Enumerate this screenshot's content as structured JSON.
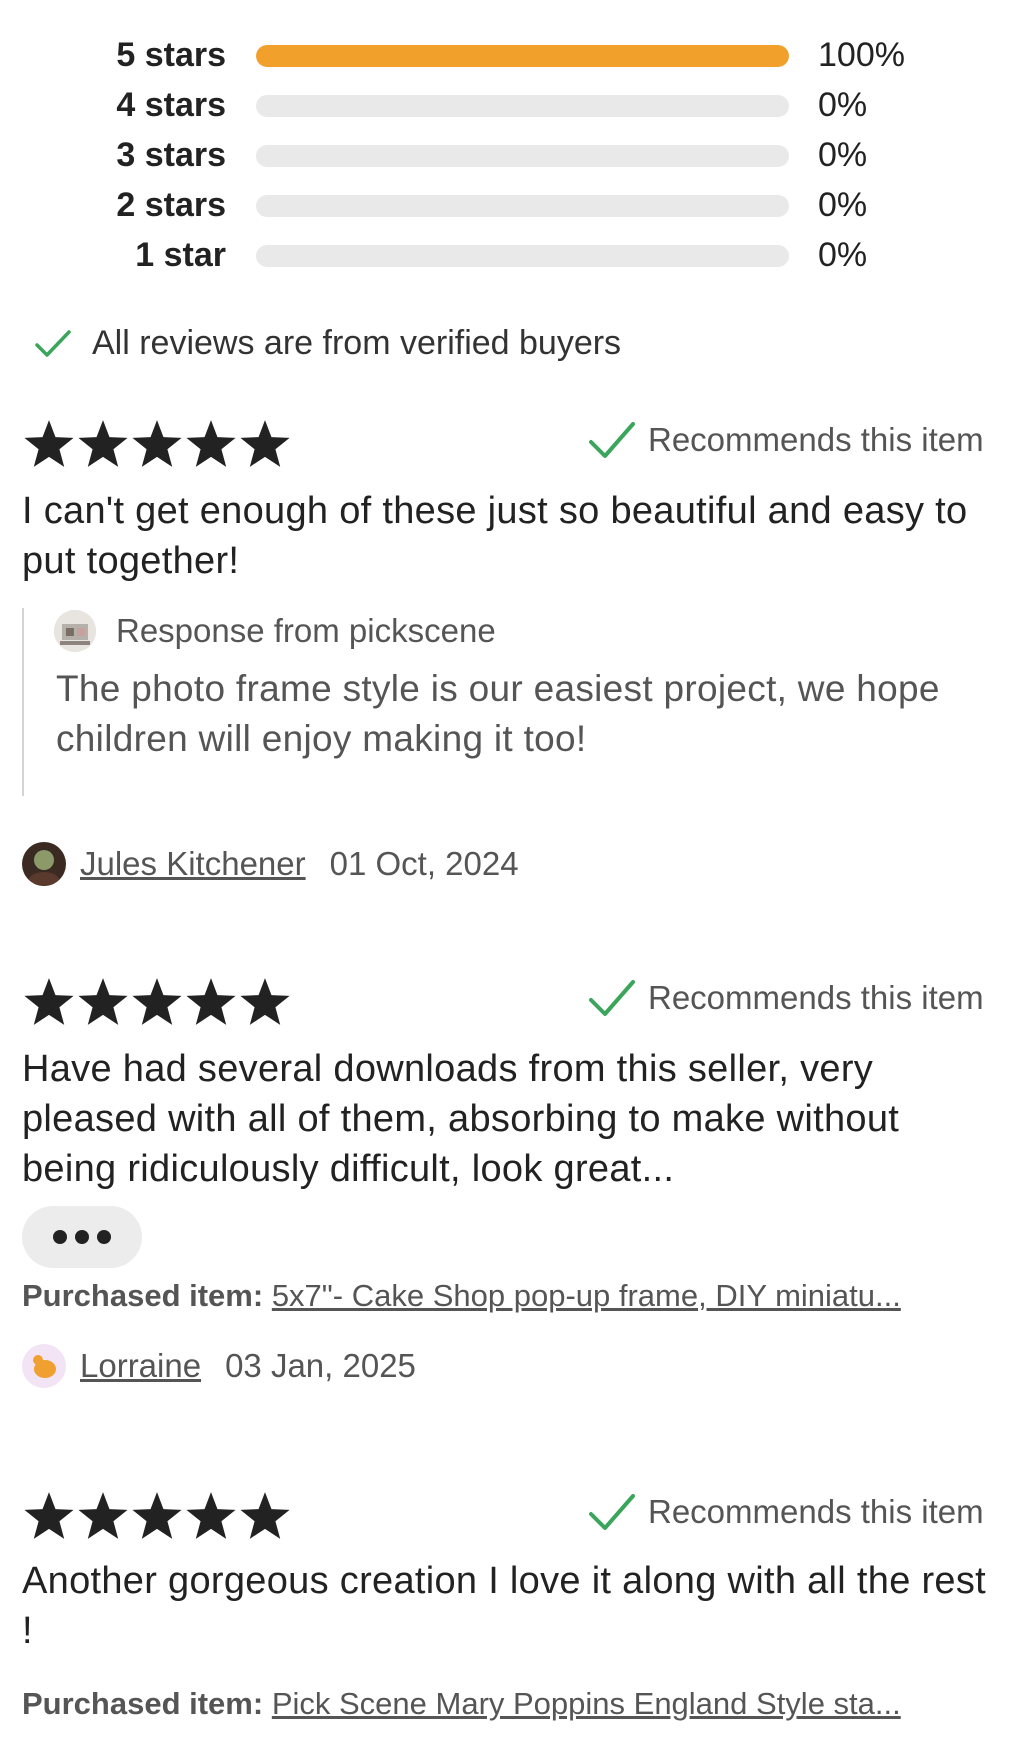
{
  "breakdown": [
    {
      "label": "5 stars",
      "percent": "100%",
      "fill": 1.0
    },
    {
      "label": "4 stars",
      "percent": "0%",
      "fill": 0
    },
    {
      "label": "3 stars",
      "percent": "0%",
      "fill": 0
    },
    {
      "label": "2 stars",
      "percent": "0%",
      "fill": 0
    },
    {
      "label": "1 star",
      "percent": "0%",
      "fill": 0
    }
  ],
  "verified_text": "All reviews are from verified buyers",
  "colors": {
    "accent_bar": "#f1a02b",
    "check_green": "#3ba55c",
    "track": "#e9e9e9"
  },
  "reviews": [
    {
      "rating": 5,
      "recommends": "Recommends this item",
      "text": "I can't get enough of these just so beautiful and easy to put together!",
      "response_header": "Response from pickscene",
      "response_text": "The photo frame style is our easiest project, we hope children will enjoy making it too!",
      "author": "Jules Kitchener",
      "date": "01 Oct, 2024"
    },
    {
      "rating": 5,
      "recommends": "Recommends this item",
      "text": "Have had several downloads from this seller, very pleased with all of them, absorbing to make without being ridiculously difficult, look great...",
      "more_icon": "ellipsis-icon",
      "purchased_label": "Purchased item:",
      "purchased_item": "5x7\"- Cake Shop pop-up frame, DIY miniatu...",
      "author": "Lorraine",
      "date": "03 Jan, 2025"
    },
    {
      "rating": 5,
      "recommends": "Recommends this item",
      "text": "Another gorgeous creation I love it along with all the rest !",
      "purchased_label": "Purchased item:",
      "purchased_item": "Pick Scene Mary Poppins England Style sta..."
    }
  ]
}
